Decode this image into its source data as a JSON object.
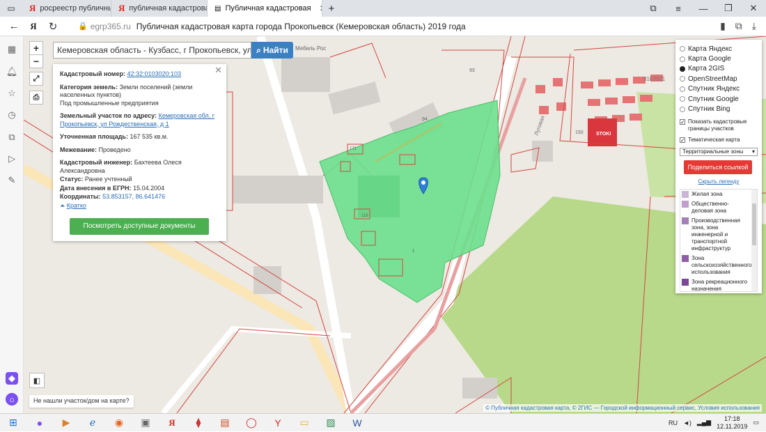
{
  "browser": {
    "tabs": [
      {
        "label": "росреестр публичные кар"
      },
      {
        "label": "публичная кадастровая к"
      },
      {
        "label": "Публичная кадастровая"
      }
    ],
    "domain": "egrp365.ru",
    "page_title": "Публичная кадастровая карта города Прокопьевск (Кемеровская область) 2019 года"
  },
  "search": {
    "value": "Кемеровская область - Кузбасс, г Прокопьевск, ул Рождест",
    "button_label": "Найти"
  },
  "map_labels": {
    "mebel": "Мебель Рос",
    "street": "Луговая",
    "block": "0103021",
    "stoki": "STOKI",
    "n94": "94",
    "n93": "93",
    "n150": "150",
    "n171": "171",
    "n1": "1",
    "n118": "118"
  },
  "info_panel": {
    "cad_label": "Кадастровый номер:",
    "cad_value": "42:32:0103020:103",
    "cat_label": "Категория земель:",
    "cat_value": "Земли поселений (земли населенных пунктов)",
    "use_value": "Под промышленные предприятия",
    "addr_label": "Земельный участок по адресу:",
    "addr_value": "Кемеровская обл, г Прокопьевск, ул Рождественская, д 1",
    "area_label": "Уточненная площадь:",
    "area_value": "167 535 кв.м.",
    "survey_label": "Межевание:",
    "survey_value": "Проведено",
    "engineer_label": "Кадастровый инженер:",
    "engineer_value": "Бахтеева Олеся Александровна",
    "status_label": "Статус:",
    "status_value": "Ранее учтенный",
    "date_label": "Дата внесения в ЕГРН:",
    "date_value": "15.04.2004",
    "coords_label": "Координаты:",
    "coords_value": "53.853157, 86.641476",
    "brief_link": "Кратко",
    "docs_button": "Посмотреть доступные документы"
  },
  "layers_panel": {
    "base_maps": [
      {
        "label": "Карта Яндекс",
        "selected": false
      },
      {
        "label": "Карта Google",
        "selected": false
      },
      {
        "label": "Карта 2GIS",
        "selected": true
      },
      {
        "label": "OpenStreetMap",
        "selected": false
      },
      {
        "label": "Спутник Яндекс",
        "selected": false
      },
      {
        "label": "Спутник Google",
        "selected": false
      },
      {
        "label": "Спутник Bing",
        "selected": false
      }
    ],
    "show_borders": "Показать кадастровые границы участков",
    "thematic": "Тематическая карта",
    "zones_select": "Территориальные зоны",
    "share_button": "Поделиться ссылкой",
    "hide_legend": "Скрыть легенду",
    "legend": [
      {
        "label": "Жилая зона",
        "color": "#cbb5d6"
      },
      {
        "label": "Общественно-деловая зона",
        "color": "#c09fcc"
      },
      {
        "label": "Производственная зона, зона инженерной и транспортной инфраструктур",
        "color": "#a47fb8"
      },
      {
        "label": "Зона сельскохозяйственного использования",
        "color": "#8e5fa6"
      },
      {
        "label": "Зона рекреационного назначения",
        "color": "#7a4896"
      }
    ]
  },
  "not_found": "Не нашли участок/дом на карте?",
  "attribution": "© Публичная кадастровая карта, © 2ГИС — Городской информационный сервис, Условия использования",
  "taskbar": {
    "lang": "RU",
    "time": "17:18",
    "date": "12.11.2019"
  }
}
